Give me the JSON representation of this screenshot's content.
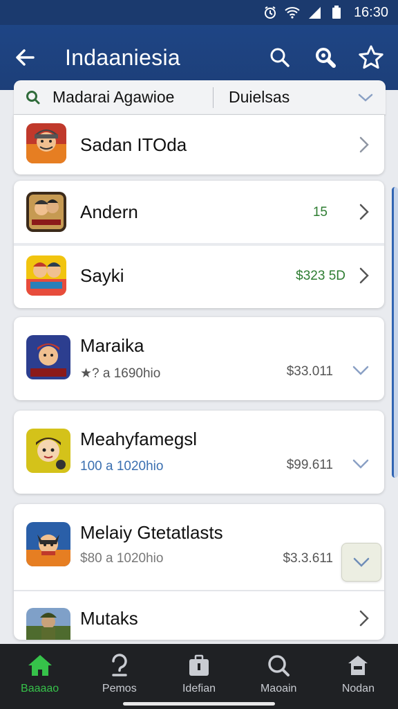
{
  "status_bar": {
    "time": "16:30"
  },
  "app_bar": {
    "title": "Indaaniesia"
  },
  "filter": {
    "primary": "Madarai  Agawioe",
    "secondary": "Duielsas"
  },
  "items": [
    {
      "title": "Sadan ITOda"
    },
    {
      "title": "Andern",
      "value": "15",
      "value_color": "#2e7d32"
    },
    {
      "title": "Sayki",
      "value": "$323 5D",
      "value_color": "#2e7d32"
    },
    {
      "title": "Maraika",
      "meta": "★? a 1690hio",
      "value": "$33.011"
    },
    {
      "title": "Meahyfamegsl",
      "meta": "100 a 1020hio",
      "value": "$99.611"
    },
    {
      "title": "Melaiy Gtetatlasts",
      "meta": "$80 a 1020hio",
      "value": "$3.3.611"
    },
    {
      "title": "Mutaks"
    }
  ],
  "bottom_nav": [
    {
      "label": "Baaaao",
      "icon": "home-icon"
    },
    {
      "label": "Pemos",
      "icon": "question-icon"
    },
    {
      "label": "Idefian",
      "icon": "briefcase-icon"
    },
    {
      "label": "Maoain",
      "icon": "search-icon"
    },
    {
      "label": "Nodan",
      "icon": "store-icon"
    }
  ],
  "colors": {
    "app_bar": "#1e4585",
    "active_nav": "#36c24a",
    "green_value": "#2e7d32",
    "meta_blue": "#3a6fb0",
    "meta_gold": "#d49a00"
  }
}
